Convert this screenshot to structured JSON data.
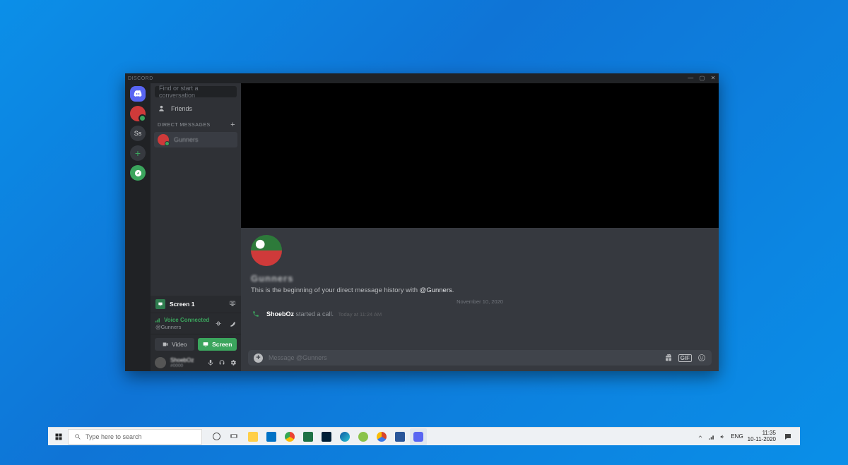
{
  "titlebar": {
    "app_name": "DISCORD"
  },
  "serverrail": {
    "items": [
      {
        "id": "home"
      },
      {
        "id": "user-avatar"
      },
      {
        "id": "ss",
        "label": "Ss"
      },
      {
        "id": "add"
      },
      {
        "id": "explore"
      }
    ]
  },
  "dmpanel": {
    "search_placeholder": "Find or start a conversation",
    "friends_label": "Friends",
    "direct_messages_label": "DIRECT MESSAGES",
    "dms": [
      {
        "name": "Gunners"
      }
    ],
    "screenshare": {
      "label": "Screen 1"
    },
    "voice": {
      "status": "Voice Connected",
      "channel": "@Gunners"
    },
    "video_button": "Video",
    "screen_button": "Screen",
    "user": {
      "name": "ShoebOz",
      "tag": "#0000"
    }
  },
  "chat": {
    "big_name": "Gunners",
    "welcome_prefix": "This is the beginning of your direct message history with ",
    "welcome_mention": "@Gunners",
    "date_divider": "November 10, 2020",
    "message": {
      "author": "ShoebOz",
      "action": "started a call.",
      "time": "Today at 11:24 AM"
    },
    "input_placeholder": "Message @Gunners"
  },
  "taskbar": {
    "search_placeholder": "Type here to search",
    "lang": "ENG",
    "time": "11:35",
    "date": "10-11-2020"
  }
}
